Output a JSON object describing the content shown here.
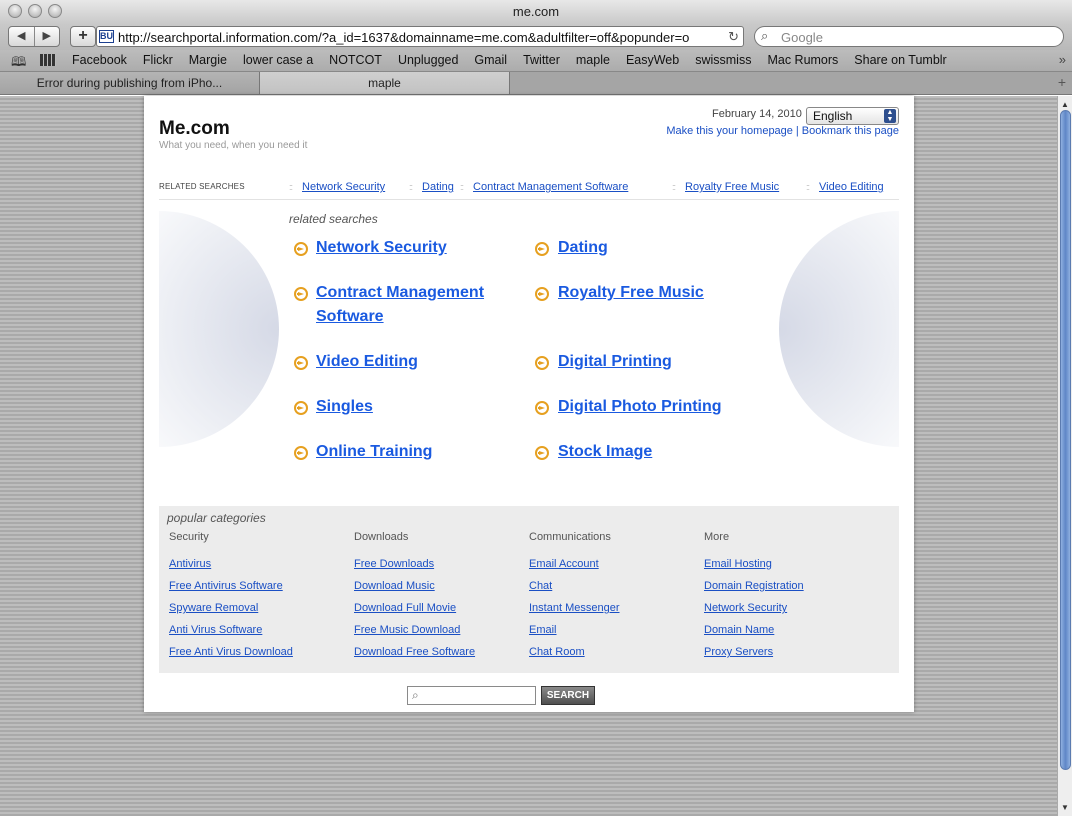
{
  "window": {
    "title": "me.com"
  },
  "toolbar": {
    "back_glyph": "◀",
    "forward_glyph": "▶",
    "add_glyph": "+",
    "favicon_text": "BU",
    "url": "http://searchportal.information.com/?a_id=1637&domainname=me.com&adultfilter=off&popunder=o",
    "reload_glyph": "↻",
    "search_placeholder": "Google",
    "search_icon_glyph": "⌕"
  },
  "bookmarks": {
    "items": [
      "Facebook",
      "Flickr",
      "Margie",
      "lower case a",
      "NOTCOT",
      "Unplugged",
      "Gmail",
      "Twitter",
      "maple",
      "EasyWeb",
      "swissmiss",
      "Mac Rumors",
      "Share on Tumblr"
    ],
    "more_glyph": "»"
  },
  "tabs": [
    {
      "label": "Error during publishing from iPho...",
      "active": false
    },
    {
      "label": "maple",
      "active": true
    }
  ],
  "newtab_glyph": "+",
  "page": {
    "logo": "Me.com",
    "tagline": "What you need, when you need it",
    "date": "February 14, 2010",
    "language": "English",
    "homepage_link": "Make this your homepage",
    "separator": "|",
    "bookmark_link": "Bookmark this page",
    "related_bar": {
      "label": "RELATED SEARCHES",
      "dots": "::",
      "items": [
        "Network Security",
        "Dating",
        "Contract Management Software",
        "Royalty Free Music",
        "Video Editing"
      ]
    },
    "related_searches": {
      "heading": "related searches",
      "left": [
        "Network Security",
        "Contract Management Software",
        "Video Editing",
        "Singles",
        "Online Training"
      ],
      "right": [
        "Dating",
        "Royalty Free Music",
        "Digital Printing",
        "Digital Photo Printing",
        "Stock Image"
      ]
    },
    "popular": {
      "heading": "popular categories",
      "columns": [
        {
          "title": "Security",
          "links": [
            "Antivirus",
            "Free Antivirus Software",
            "Spyware Removal",
            "Anti Virus Software",
            "Free Anti Virus Download"
          ]
        },
        {
          "title": "Downloads",
          "links": [
            "Free Downloads",
            "Download Music",
            "Download Full Movie",
            "Free Music Download",
            "Download Free Software"
          ]
        },
        {
          "title": "Communications",
          "links": [
            "Email Account",
            "Chat",
            "Instant Messenger",
            "Email",
            "Chat Room"
          ]
        },
        {
          "title": "More",
          "links": [
            "Email Hosting",
            "Domain Registration",
            "Network Security",
            "Domain Name",
            "Proxy Servers"
          ]
        }
      ]
    },
    "search_button": "SEARCH",
    "search_icon_glyph": "⌕"
  },
  "colors": {
    "link": "#1a4fc4",
    "big_link": "#1a5ae0",
    "arrow": "#e6a020",
    "scroll_thumb": "#5e86c6"
  }
}
